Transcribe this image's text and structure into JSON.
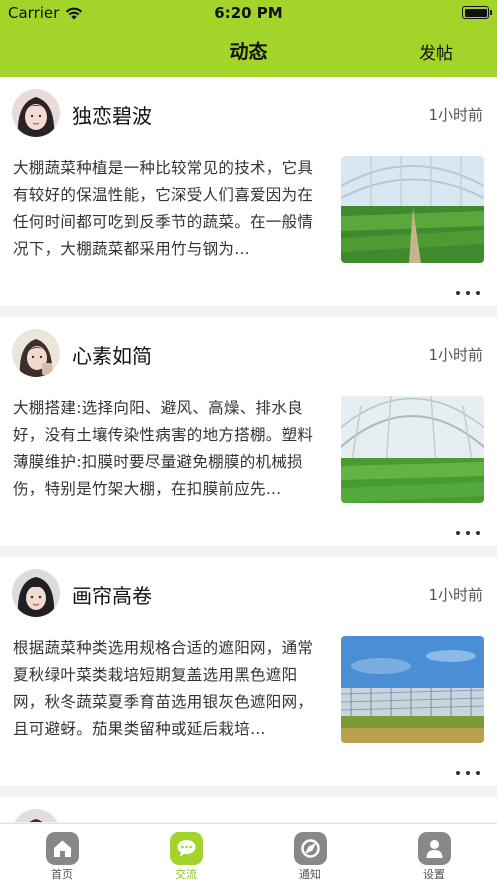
{
  "status_bar": {
    "carrier": "Carrier",
    "time": "6:20 PM"
  },
  "nav": {
    "title": "动态",
    "post_label": "发帖"
  },
  "colors": {
    "accent": "#a3d42a",
    "tab_inactive": "#888888"
  },
  "posts": [
    {
      "username": "独恋碧波",
      "time": "1小时前",
      "text": "大棚蔬菜种植是一种比较常见的技术，它具有较好的保温性能，它深受人们喜爱因为在任何时间都可吃到反季节的蔬菜。在一般情况下，大棚蔬菜都采用竹与钢为…"
    },
    {
      "username": "心素如简",
      "time": "1小时前",
      "text": "大棚搭建:选择向阳、避风、高燥、排水良好，没有土壤传染性病害的地方搭棚。塑料薄膜维护:扣膜时要尽量避免棚膜的机械损伤，特别是竹架大棚，在扣膜前应先…"
    },
    {
      "username": "画帘高卷",
      "time": "1小时前",
      "text": "根据蔬菜种类选用规格合适的遮阳网，通常夏秋绿叶菜类栽培短期复盖选用黑色遮阳网，秋冬蔬菜夏季育苗选用银灰色遮阳网，且可避蚜。茄果类留种或延后栽培…"
    }
  ],
  "tabs": [
    {
      "label": "首页",
      "icon": "home-icon"
    },
    {
      "label": "交流",
      "icon": "chat-icon"
    },
    {
      "label": "通知",
      "icon": "compass-icon"
    },
    {
      "label": "设置",
      "icon": "person-icon"
    }
  ]
}
